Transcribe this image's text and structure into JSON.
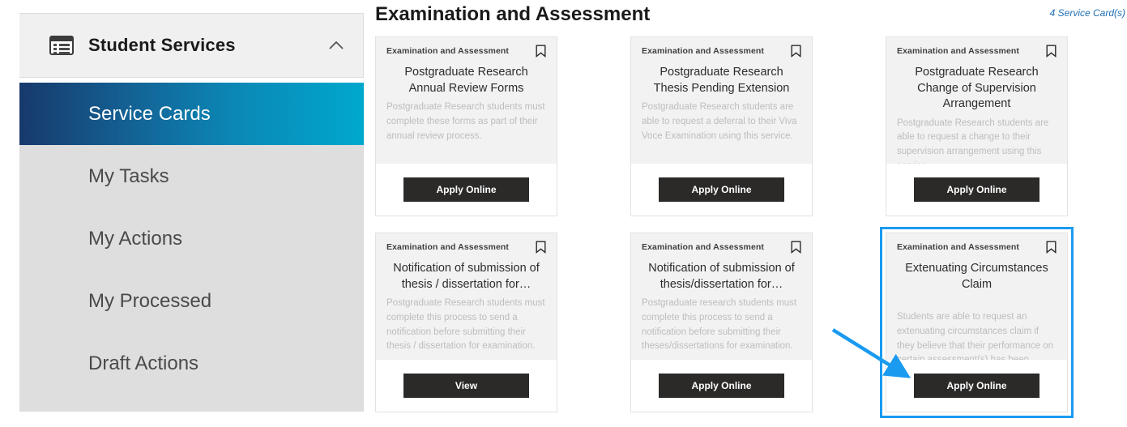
{
  "sidebar": {
    "title": "Student Services",
    "icon": "list-panel-icon",
    "collapse_icon": "chevron-up-icon",
    "accent_color": "#4cb3d4",
    "active_gradient_from": "#17396b",
    "active_gradient_to": "#00a8ce",
    "items": [
      {
        "label": "Service Cards",
        "active": true
      },
      {
        "label": "My Tasks",
        "active": false
      },
      {
        "label": "My Actions",
        "active": false
      },
      {
        "label": "My Processed",
        "active": false
      },
      {
        "label": "Draft Actions",
        "active": false
      }
    ]
  },
  "main": {
    "title": "Examination and Assessment",
    "count_label": "4 Service Card(s)",
    "count_color": "#1f6fb5",
    "highlight_color": "#1a9bf0",
    "button_color": "#2b2a29",
    "bookmark_icon": "bookmark-icon",
    "cards": [
      {
        "category": "Examination and Assessment",
        "title": "Postgraduate Research Annual Review Forms",
        "description": "Postgraduate Research students must complete these forms as part of their annual review process.",
        "button": "Apply Online",
        "highlighted": false
      },
      {
        "category": "Examination and Assessment",
        "title": "Postgraduate Research Thesis Pending Extension",
        "description": "Postgraduate Research students are able to request a deferral to their Viva Voce Examination using this service.",
        "button": "Apply Online",
        "highlighted": false
      },
      {
        "category": "Examination and Assessment",
        "title": "Postgraduate Research Change of Supervision Arrangement",
        "description": "Postgraduate Research students are able to request a change to their supervision arrangement using this service.",
        "button": "Apply Online",
        "highlighted": false
      },
      {
        "category": "Examination and Assessment",
        "title": "Notification of submission of thesis / dissertation for…",
        "description": "Postgraduate Research students must complete this process to send a notification before submitting their thesis / dissertation for examination.",
        "button": "View",
        "highlighted": false
      },
      {
        "category": "Examination and Assessment",
        "title": "Notification of submission of thesis/dissertation for…",
        "description": "Postgraduate research students must complete this process to send a notification before submitting their theses/dissertations for examination.",
        "button": "Apply Online",
        "highlighted": false
      },
      {
        "category": "Examination and Assessment",
        "title": "Extenuating Circumstances Claim",
        "description": "Students are able to request an extenuating circumstances claim if they believe that their performance on certain assessment(s) has been…",
        "button": "Apply Online",
        "highlighted": true
      }
    ]
  },
  "annotation": {
    "arrow_color": "#1a9bf0",
    "icon": "arrow-pointer-icon"
  }
}
